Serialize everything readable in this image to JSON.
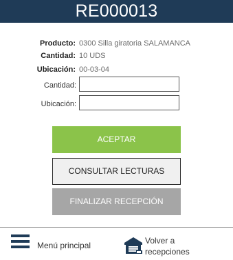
{
  "header": {
    "title": "RE000013"
  },
  "details": {
    "producto_label": "Producto:",
    "producto_value": "0300 Silla giratoria SALAMANCA",
    "cantidad_label": "Cantidad:",
    "cantidad_value": "10 UDS",
    "ubicacion_label": "Ubicación:",
    "ubicacion_value": "00-03-04"
  },
  "form": {
    "cantidad_label": "Cantidad:",
    "cantidad_value": "",
    "ubicacion_label": "Ubicación:",
    "ubicacion_value": ""
  },
  "buttons": {
    "accept": "ACEPTAR",
    "consult": "CONSULTAR LECTURAS",
    "finish": "FINALIZAR RECEPCIÓN"
  },
  "footer": {
    "menu_label": "Menú principal",
    "back_label": "Volver a\nrecepciones"
  },
  "colors": {
    "header_bg": "#1f3b57",
    "accept_bg": "#8bc34a",
    "finish_bg": "#a6a6a6"
  },
  "icons": {
    "menu": "hamburger-icon",
    "back": "warehouse-icon"
  }
}
